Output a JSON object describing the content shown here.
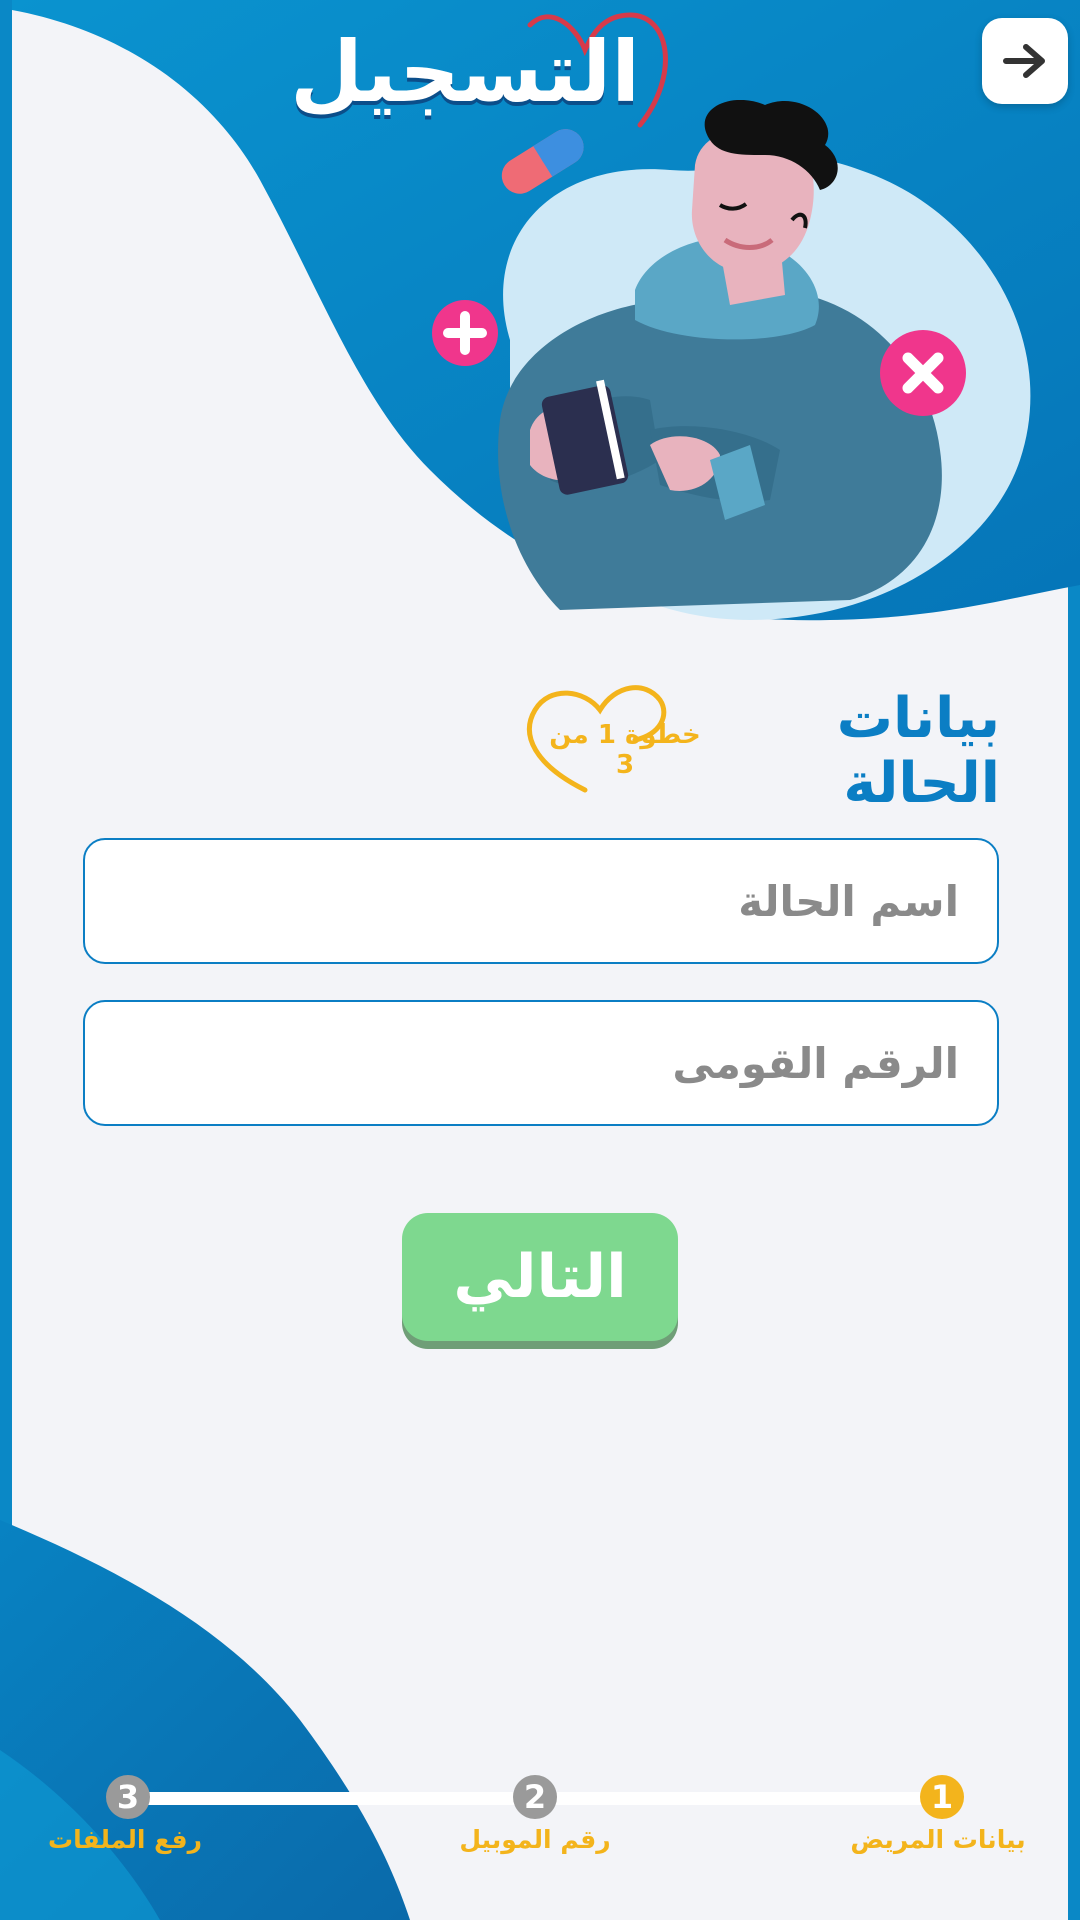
{
  "header": {
    "title": "التسجيل"
  },
  "section": {
    "title": "بيانات الحالة",
    "step_indicator": "خطوة 1 من 3"
  },
  "form": {
    "case_name_placeholder": "اسم الحالة",
    "case_name_value": "",
    "national_id_placeholder": "الرقم القومى",
    "national_id_value": ""
  },
  "actions": {
    "next_label": "التالي"
  },
  "steps": [
    {
      "number": "1",
      "label": "بيانات المريض",
      "status": "active"
    },
    {
      "number": "2",
      "label": "رقم الموبيل",
      "status": "inactive"
    },
    {
      "number": "3",
      "label": "رفع الملفات",
      "status": "inactive"
    }
  ],
  "icons": {
    "back": "arrow-right-icon",
    "plus": "plus-badge-icon",
    "cross": "x-badge-icon",
    "pill": "pill-icon",
    "heart": "heart-icon"
  },
  "colors": {
    "primary_blue": "#0b7ec4",
    "accent_yellow": "#f3b41c",
    "next_green": "#7ed88f",
    "inactive_step": "#9a9a9a",
    "badge_pink": "#f0368c",
    "background": "#f3f4f8"
  }
}
